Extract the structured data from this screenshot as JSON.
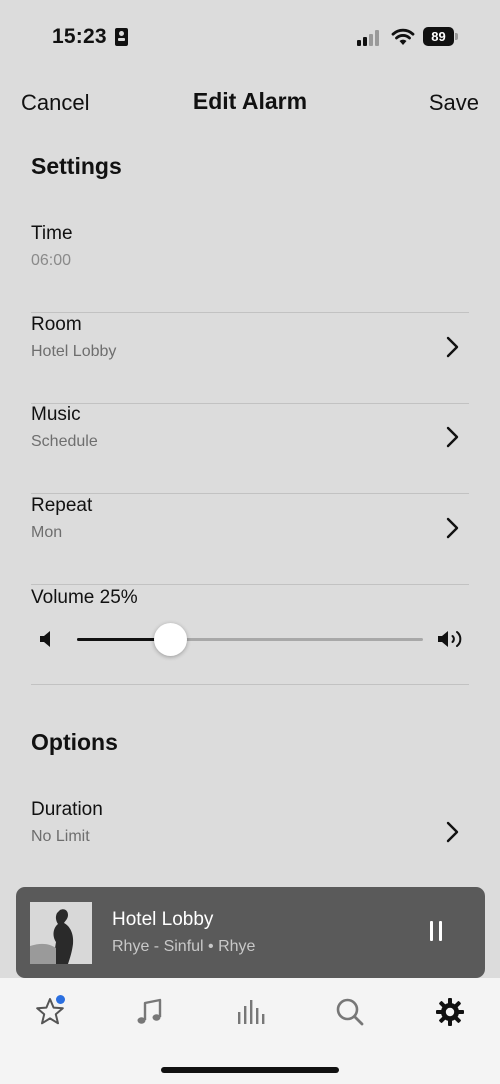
{
  "status_bar": {
    "time": "15:23",
    "battery": "89",
    "icons": [
      "id-badge-icon",
      "cellular-signal-icon",
      "wifi-icon",
      "battery-icon"
    ]
  },
  "nav": {
    "cancel_label": "Cancel",
    "title": "Edit Alarm",
    "save_label": "Save"
  },
  "settings": {
    "section_title": "Settings",
    "rows": [
      {
        "label": "Time",
        "value": "06:00",
        "has_chevron": false
      },
      {
        "label": "Room",
        "value": "Hotel Lobby",
        "has_chevron": true
      },
      {
        "label": "Music",
        "value": "Schedule",
        "has_chevron": true
      },
      {
        "label": "Repeat",
        "value": "Mon",
        "has_chevron": true
      }
    ],
    "volume": {
      "label": "Volume 25%",
      "level": 0.27
    }
  },
  "options": {
    "section_title": "Options",
    "rows": [
      {
        "label": "Duration",
        "value": "No Limit",
        "has_chevron": true
      }
    ]
  },
  "now_playing": {
    "title": "Hotel Lobby",
    "subtitle": "Rhye - Sinful • Rhye",
    "state": "playing"
  },
  "tab_bar": {
    "items": [
      {
        "icon": "star-icon",
        "badge": true
      },
      {
        "icon": "music-note-icon",
        "badge": false
      },
      {
        "icon": "rooms-bars-icon",
        "badge": false
      },
      {
        "icon": "search-icon",
        "badge": false
      },
      {
        "icon": "gear-icon",
        "badge": false,
        "selected": true
      }
    ]
  },
  "colors": {
    "background": "#dcdcdc",
    "text": "#111111",
    "secondary_text": "#6e6e6e",
    "now_playing_bg": "#5a5a5a",
    "badge_blue": "#2b6fe0",
    "tab_bar_bg": "#f4f4f4"
  }
}
